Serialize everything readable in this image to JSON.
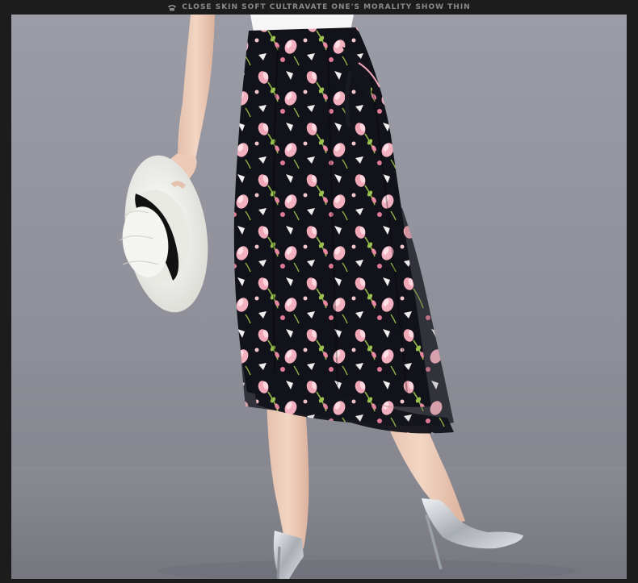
{
  "header": {
    "caption": "CLOSE SKIN SOFT CULTRAVATE ONE'S MORALITY SHOW THIN",
    "icon": "phone-icon"
  },
  "colors": {
    "page_border": "#1c1c1c",
    "header_text": "#8a8a8a",
    "backdrop_top": "#9a9aa3",
    "backdrop_bottom": "#83838c",
    "skirt": "#101018",
    "petal": "#f2a0b0",
    "leaf": "#8fb548",
    "hat": "#f2f2ee",
    "hat_band": "#111111",
    "shoe": "#c9ccd1"
  }
}
